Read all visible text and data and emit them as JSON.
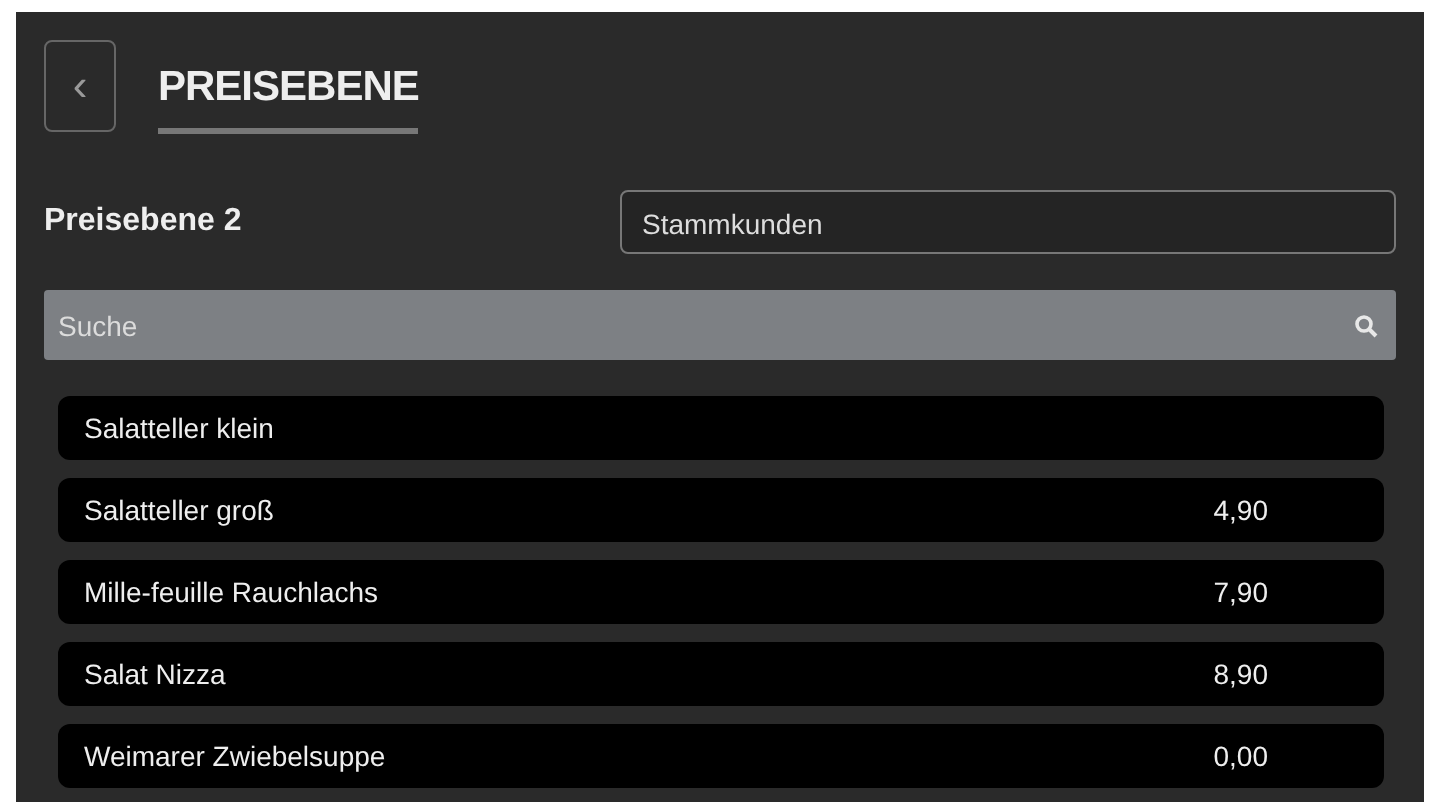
{
  "header": {
    "back_icon": "‹",
    "title": "PREISEBENE"
  },
  "price_level": {
    "label": "Preisebene 2",
    "value": "Stammkunden"
  },
  "search": {
    "placeholder": "Suche"
  },
  "items": [
    {
      "name": "Salatteller klein"
    },
    {
      "name": "Salatteller groß",
      "price": "4,90"
    },
    {
      "name": "Mille-feuille Rauchlachs",
      "price": "7,90"
    },
    {
      "name": "Salat Nizza",
      "price": "8,90"
    },
    {
      "name": "Weimarer Zwiebelsuppe",
      "price": "0,00"
    }
  ]
}
